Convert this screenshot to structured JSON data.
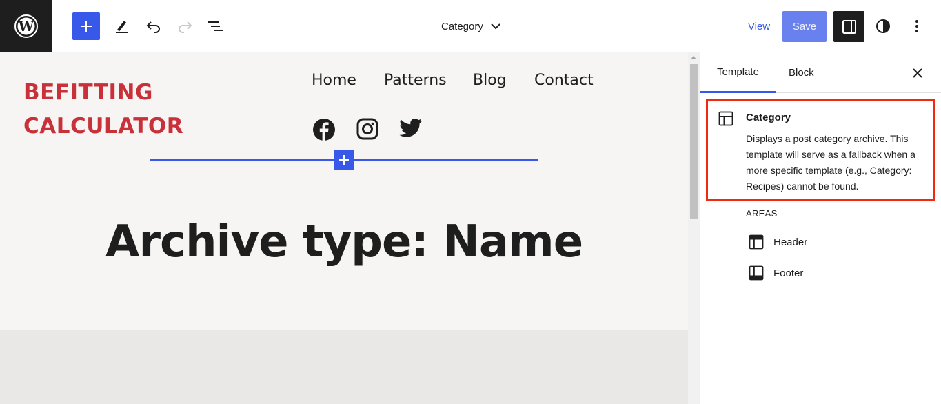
{
  "toolbar": {
    "document_title": "Category",
    "view_label": "View",
    "save_label": "Save"
  },
  "canvas": {
    "site_title_line1": "BEFITTING",
    "site_title_line2": "CALCULATOR",
    "nav_items": [
      "Home",
      "Patterns",
      "Blog",
      "Contact"
    ],
    "social_icons": [
      "facebook-icon",
      "instagram-icon",
      "twitter-icon"
    ],
    "archive_title": "Archive type: Name"
  },
  "sidebar": {
    "tabs": [
      "Template",
      "Block"
    ],
    "active_tab": "Template",
    "template_name": "Category",
    "template_description": "Displays a post category archive. This template will serve as a fallback when a more specific template (e.g., Category: Recipes) cannot be found.",
    "areas_label": "AREAS",
    "areas": [
      {
        "label": "Header",
        "icon": "header-icon"
      },
      {
        "label": "Footer",
        "icon": "footer-icon"
      }
    ]
  },
  "colors": {
    "accent": "#3858e9",
    "site_title": "#c8303a",
    "highlight_border": "#ee2b10",
    "dark": "#1e1e1e"
  }
}
